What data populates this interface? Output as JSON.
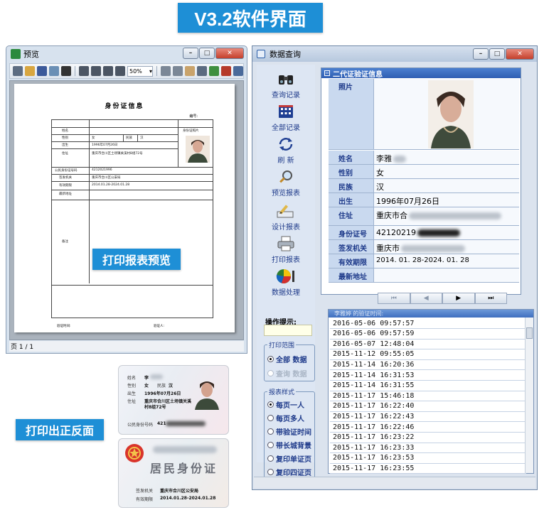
{
  "banner": {
    "title": "V3.2软件界面"
  },
  "labels": {
    "print_preview": "打印报表预览",
    "print_front_back": "打印出正反面"
  },
  "preview_window": {
    "title": "预览",
    "zoom": "50%",
    "status": "页 1 / 1",
    "report": {
      "title": "身份证信息",
      "number_label": "编号:",
      "photo_caption": "身份证照片",
      "rows": [
        "姓名",
        "性别",
        "出生",
        "住址",
        "公民身份证号码",
        "签发机关",
        "有效期限",
        "最新地址",
        "备注"
      ],
      "gender_value": "女",
      "ethnicity_label": "民族",
      "ethnicity_value": "汉",
      "birth_value": "1996年07月26日",
      "address_value": "重庆市合川区土场镇关溪村8组72号",
      "id_value": "4212021996",
      "authority_value": "重庆市合川区公安局",
      "validity_value": "2014.01.28-2024.01.28",
      "footer_left": "验证时间:",
      "footer_right": "验证人:"
    }
  },
  "card_front": {
    "name_label": "姓名",
    "name_value": "李",
    "gender_label": "性别",
    "gender_value": "女",
    "ethnic_label": "民族",
    "ethnic_value": "汉",
    "birth_label": "出生",
    "birth_value": "1996年07月26日",
    "addr_label": "住址",
    "addr_value": "重庆市合川区土场镇关溪",
    "addr_value2": "村8组72号",
    "id_label": "公民身份号码",
    "id_value": "421"
  },
  "card_back": {
    "title": "居民身份证",
    "authority_label": "签发机关",
    "authority_value": "重庆市合川区公安局",
    "validity_label": "有效期限",
    "validity_value": "2014.01.28-2024.01.28"
  },
  "query_window": {
    "title": "数据查询",
    "sidebar": [
      {
        "label": "查询记录",
        "icon": "binoculars-icon"
      },
      {
        "label": "全部记录",
        "icon": "grid-icon"
      },
      {
        "label": "刷  新",
        "icon": "refresh-icon"
      },
      {
        "label": "预览报表",
        "icon": "magnifier-icon"
      },
      {
        "label": "设计报表",
        "icon": "pencil-icon"
      },
      {
        "label": "打印报表",
        "icon": "printer-icon"
      },
      {
        "label": "数据处理",
        "icon": "pie-chart-icon"
      }
    ],
    "hint_label": "操作提示:",
    "print_range": {
      "title": "打印范围",
      "options": [
        "全部 数据",
        "查询 数据"
      ]
    },
    "report_style": {
      "title": "报表样式",
      "options": [
        "每页一人",
        "每页多人",
        "带验证时间",
        "带长城背景",
        "复印单证页",
        "复印四证页"
      ]
    },
    "info": {
      "header": "二代证验证信息",
      "photo_label": "照片",
      "rows": [
        {
          "label": "姓名",
          "value": "李雅"
        },
        {
          "label": "性别",
          "value": "女"
        },
        {
          "label": "民族",
          "value": "汉"
        },
        {
          "label": "出生",
          "value": "1996年07月26日"
        },
        {
          "label": "住址",
          "value": "重庆市合"
        },
        {
          "label": "身份证号",
          "value": "42120219"
        },
        {
          "label": "签发机关",
          "value": "重庆市"
        },
        {
          "label": "有效期限",
          "value": "2014. 01. 28-2024. 01. 28"
        },
        {
          "label": "最新地址",
          "value": ""
        }
      ]
    },
    "nav": [
      "⏮",
      "◀",
      "▶",
      "⏭"
    ],
    "times_header": "李雅婷 的验证时间:",
    "times": [
      "2016-05-06 09:57:57",
      "2016-05-06 09:57:59",
      "2016-05-07 12:48:04",
      "2015-11-12 09:55:05",
      "2015-11-14 16:20:36",
      "2015-11-14 16:31:53",
      "2015-11-14 16:31:55",
      "2015-11-17 15:46:18",
      "2015-11-17 16:22:40",
      "2015-11-17 16:22:43",
      "2015-11-17 16:22:46",
      "2015-11-17 16:23:22",
      "2015-11-17 16:23:33",
      "2015-11-17 16:23:53",
      "2015-11-17 16:23:55"
    ]
  }
}
